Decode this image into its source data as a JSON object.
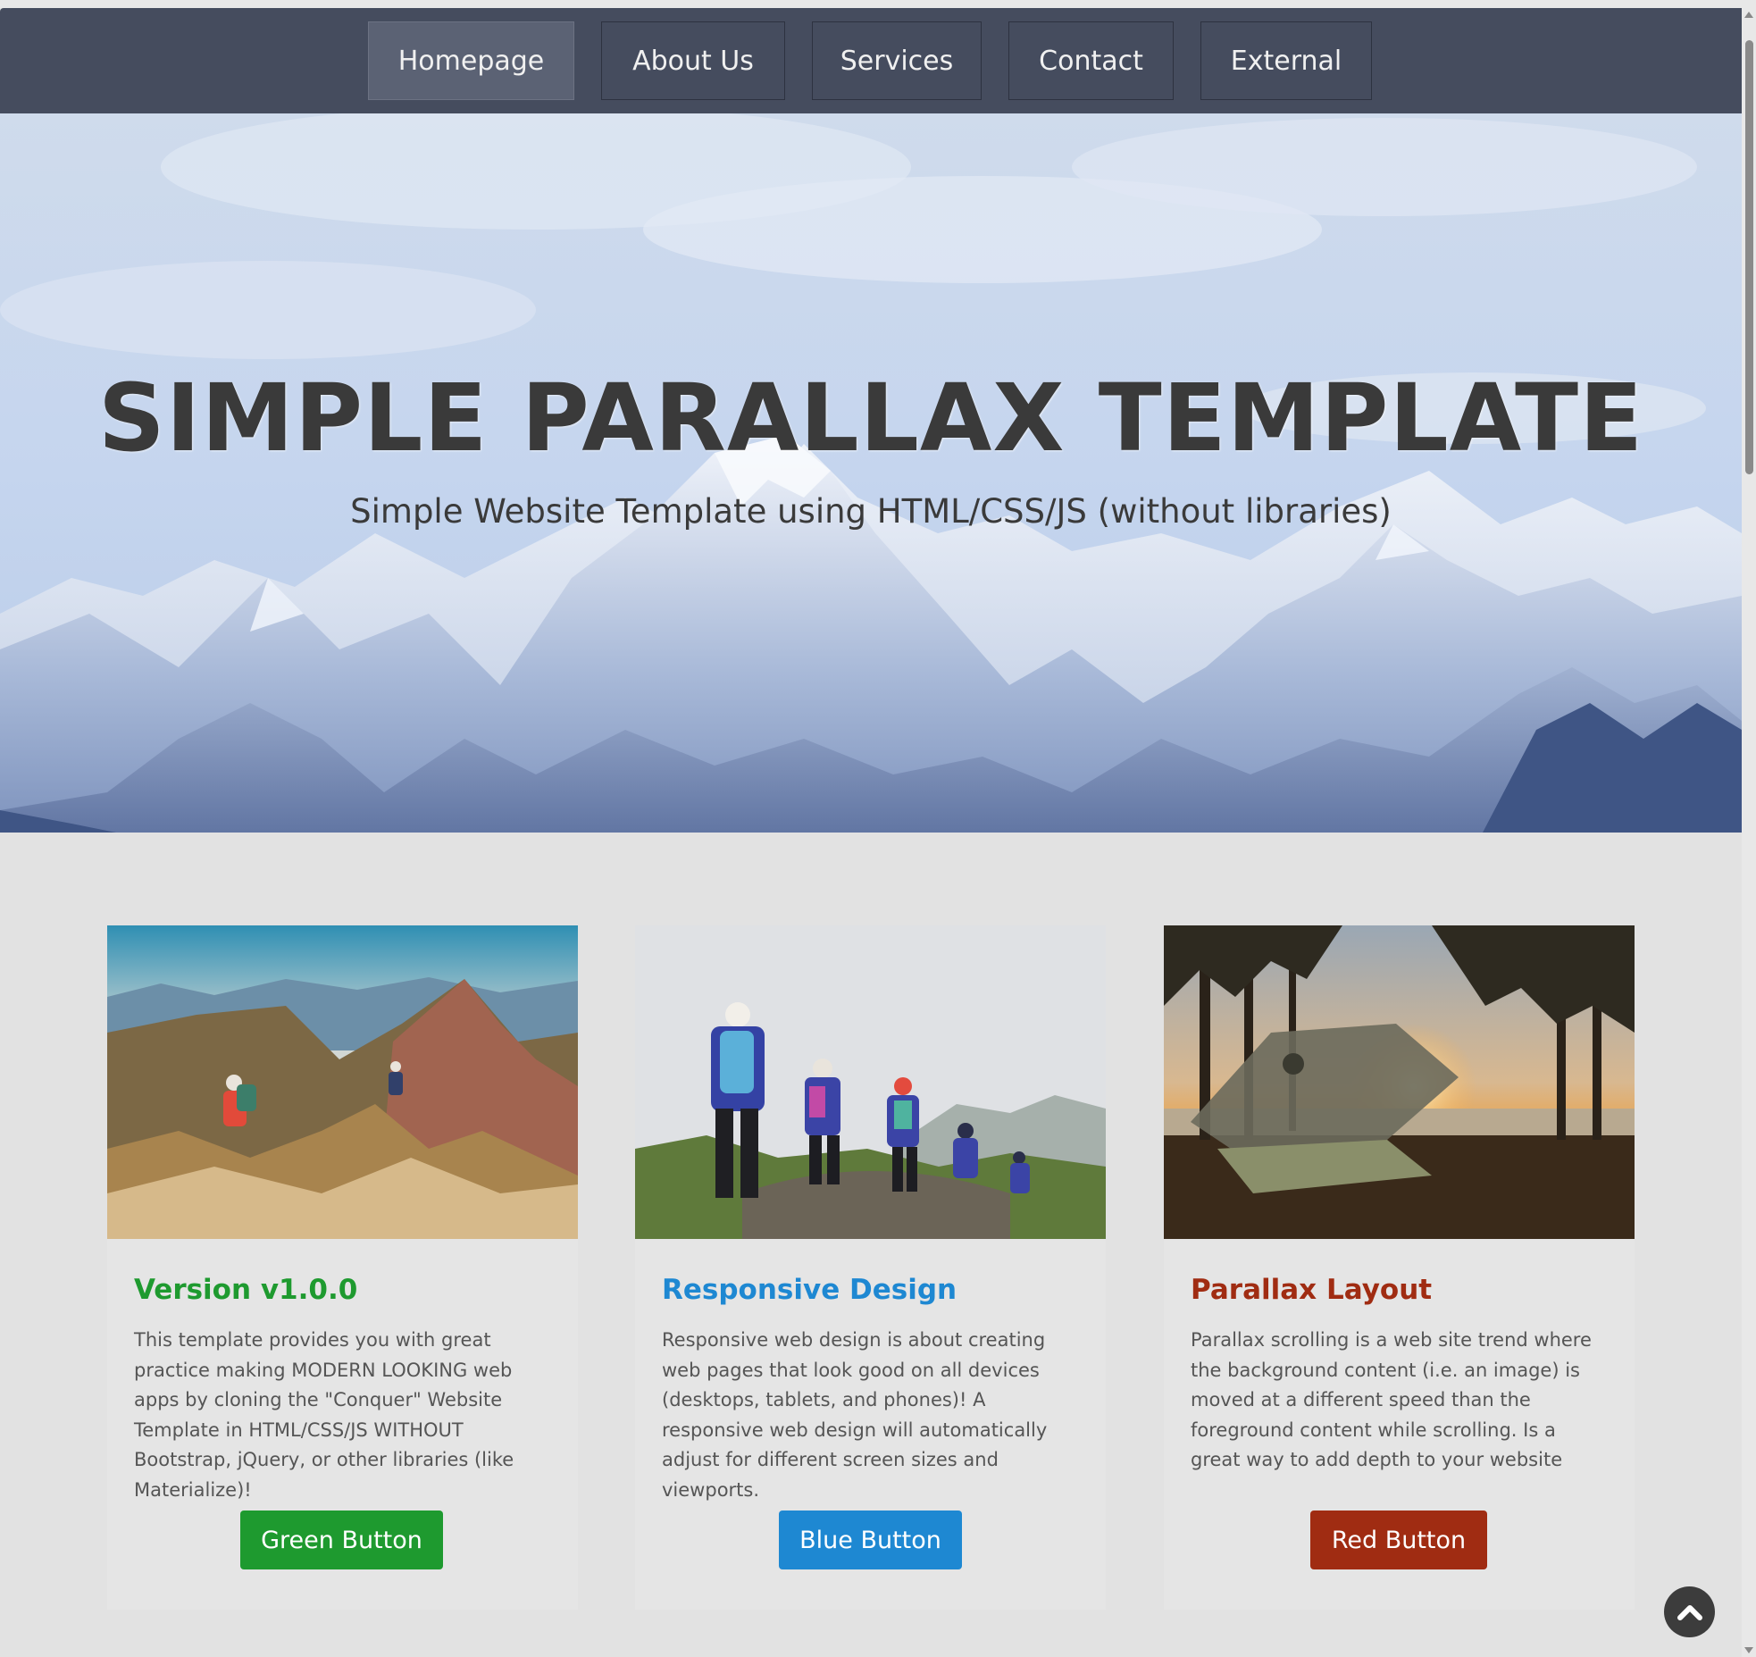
{
  "nav": {
    "items": [
      {
        "label": "Homepage",
        "active": true
      },
      {
        "label": "About Us",
        "active": false
      },
      {
        "label": "Services",
        "active": false
      },
      {
        "label": "Contact",
        "active": false
      },
      {
        "label": "External",
        "active": false
      }
    ]
  },
  "hero": {
    "title": "SIMPLE PARALLAX TEMPLATE",
    "subtitle": "Simple Website Template using HTML/CSS/JS (without libraries)"
  },
  "cards": [
    {
      "title": "Version v1.0.0",
      "text": "This template provides you with great practice making MODERN LOOKING web apps by cloning the \"Conquer\" Website Template in HTML/CSS/JS WITHOUT Bootstrap, jQuery, or other libraries (like Materialize)!",
      "button": "Green Button",
      "color": "#1e9a2f"
    },
    {
      "title": "Responsive Design",
      "text": "Responsive web design is about creating web pages that look good on all devices (desktops, tablets, and phones)! A responsive web design will automatically adjust for different screen sizes and viewports.",
      "button": "Blue Button",
      "color": "#1e88d2"
    },
    {
      "title": "Parallax Layout",
      "text": "Parallax scrolling is a web site trend where the background content (i.e. an image) is moved at a different speed than the foreground content while scrolling. Is a great way to add depth to your website",
      "button": "Red Button",
      "color": "#a02c12"
    }
  ],
  "icons": {
    "back_to_top": "chevron-up-icon"
  }
}
